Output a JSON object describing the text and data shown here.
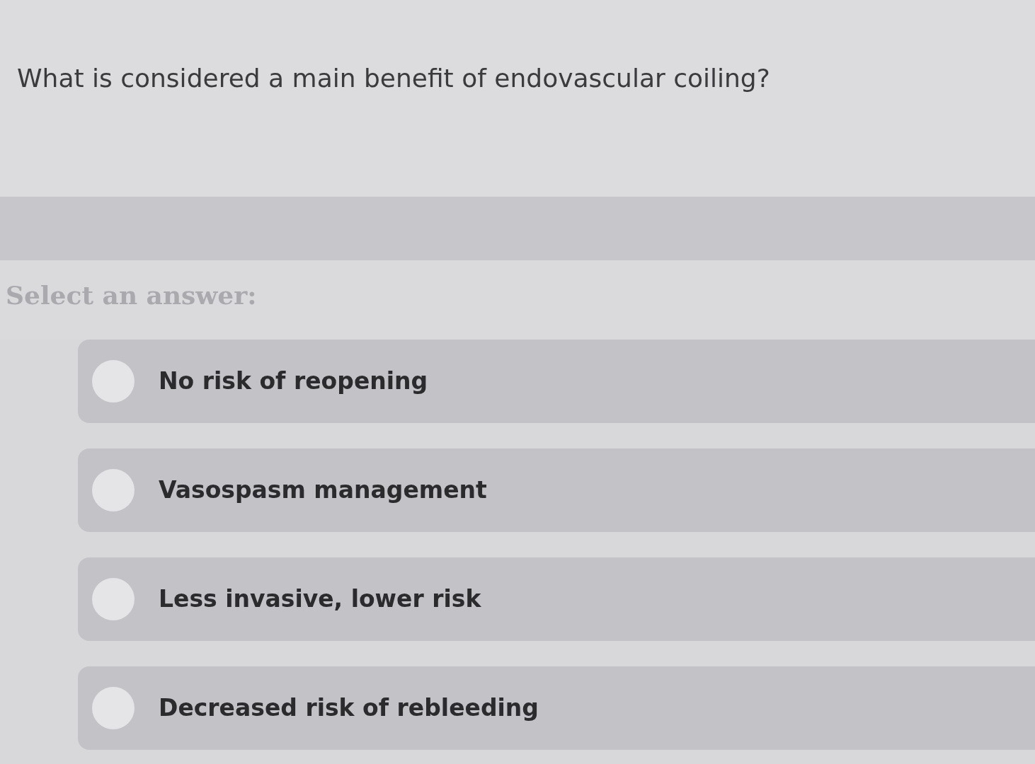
{
  "question": {
    "text": "What is considered a main benefit of endovascular coiling?"
  },
  "answer_prompt": "Select an answer:",
  "options": [
    {
      "label": "No risk of reopening",
      "selected": false
    },
    {
      "label": "Vasospasm management",
      "selected": false
    },
    {
      "label": "Less invasive, lower risk",
      "selected": false
    },
    {
      "label": "Decreased risk of rebleeding",
      "selected": false
    }
  ]
}
